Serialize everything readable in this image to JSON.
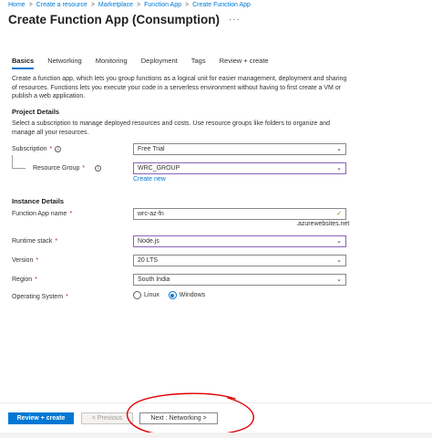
{
  "breadcrumb": [
    "Home",
    "Create a resource",
    "Marketplace",
    "Function App",
    "Create Function App"
  ],
  "breadcrumb_separator": ">",
  "title": "Create Function App (Consumption)",
  "more_icon": "···",
  "tabs": [
    "Basics",
    "Networking",
    "Monitoring",
    "Deployment",
    "Tags",
    "Review + create"
  ],
  "intro": "Create a function app, which lets you group functions as a logical unit for easier management, deployment and sharing of resources. Functions lets you execute your code in a serverless environment without having to first create a VM or publish a web application.",
  "project": {
    "title": "Project Details",
    "desc": "Select a subscription to manage deployed resources and costs. Use resource groups like folders to organize and manage all your resources.",
    "subscription_label": "Subscription",
    "subscription_value": "Free Trial",
    "resource_group_label": "Resource Group",
    "resource_group_value": "WRC_GROUP",
    "create_new": "Create new"
  },
  "instance": {
    "title": "Instance Details",
    "name_label": "Function App name",
    "name_value": "wrc-az-fn",
    "name_suffix": ".azurewebsites.net",
    "runtime_label": "Runtime stack",
    "runtime_value": "Node.js",
    "version_label": "Version",
    "version_value": "20 LTS",
    "region_label": "Region",
    "region_value": "South India",
    "os_label": "Operating System",
    "os_options": [
      "Linux",
      "Windows"
    ],
    "os_selected": "Windows"
  },
  "required_marker": "*",
  "info_glyph": "i",
  "chevron_glyph": "⌄",
  "check_glyph": "✓",
  "footer": {
    "review_create": "Review + create",
    "previous": "< Previous",
    "next": "Next : Networking >"
  },
  "colors": {
    "accent": "#0078d4",
    "focus_border": "#8764b8",
    "annotation_red": "#e00000",
    "valid_check": "#57a300"
  }
}
